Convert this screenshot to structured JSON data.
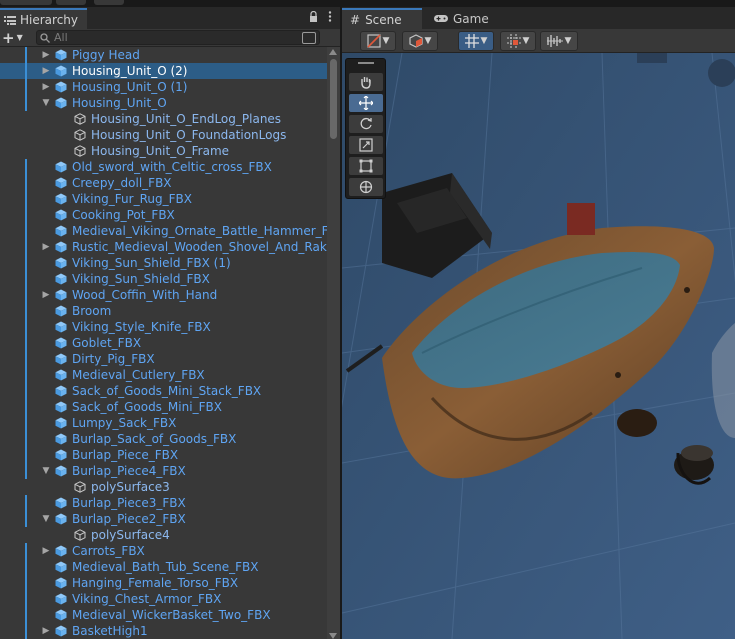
{
  "hierarchy": {
    "tab_title": "Hierarchy",
    "search_placeholder": "All",
    "items": [
      {
        "name": "Piggy Head",
        "arrow": "right",
        "depth": 0,
        "bar": true
      },
      {
        "name": "Housing_Unit_O (2)",
        "arrow": "right",
        "depth": 0,
        "bar": true,
        "selected": true
      },
      {
        "name": "Housing_Unit_O (1)",
        "arrow": "right",
        "depth": 0,
        "bar": true
      },
      {
        "name": "Housing_Unit_O",
        "arrow": "down",
        "depth": 0,
        "bar": true
      },
      {
        "name": "Housing_Unit_O_EndLog_Planes",
        "arrow": "",
        "depth": 1,
        "bar": false,
        "outline": true
      },
      {
        "name": "Housing_Unit_O_FoundationLogs",
        "arrow": "",
        "depth": 1,
        "bar": false,
        "outline": true
      },
      {
        "name": "Housing_Unit_O_Frame",
        "arrow": "",
        "depth": 1,
        "bar": false,
        "outline": true
      },
      {
        "name": "Old_sword_with_Celtic_cross_FBX",
        "arrow": "",
        "depth": 0,
        "bar": true
      },
      {
        "name": "Creepy_doll_FBX",
        "arrow": "",
        "depth": 0,
        "bar": true
      },
      {
        "name": "Viking_Fur_Rug_FBX",
        "arrow": "",
        "depth": 0,
        "bar": true
      },
      {
        "name": "Cooking_Pot_FBX",
        "arrow": "",
        "depth": 0,
        "bar": true
      },
      {
        "name": "Medieval_Viking_Ornate_Battle_Hammer_FBX",
        "arrow": "",
        "depth": 0,
        "bar": true
      },
      {
        "name": "Rustic_Medieval_Wooden_Shovel_And_Rake_",
        "arrow": "right",
        "depth": 0,
        "bar": true
      },
      {
        "name": "Viking_Sun_Shield_FBX (1)",
        "arrow": "",
        "depth": 0,
        "bar": true
      },
      {
        "name": "Viking_Sun_Shield_FBX",
        "arrow": "",
        "depth": 0,
        "bar": true
      },
      {
        "name": "Wood_Coffin_With_Hand",
        "arrow": "right",
        "depth": 0,
        "bar": true
      },
      {
        "name": "Broom",
        "arrow": "",
        "depth": 0,
        "bar": true
      },
      {
        "name": "Viking_Style_Knife_FBX",
        "arrow": "",
        "depth": 0,
        "bar": true
      },
      {
        "name": "Goblet_FBX",
        "arrow": "",
        "depth": 0,
        "bar": true
      },
      {
        "name": "Dirty_Pig_FBX",
        "arrow": "",
        "depth": 0,
        "bar": true
      },
      {
        "name": "Medieval_Cutlery_FBX",
        "arrow": "",
        "depth": 0,
        "bar": true
      },
      {
        "name": "Sack_of_Goods_Mini_Stack_FBX",
        "arrow": "",
        "depth": 0,
        "bar": true
      },
      {
        "name": "Sack_of_Goods_Mini_FBX",
        "arrow": "",
        "depth": 0,
        "bar": true
      },
      {
        "name": "Lumpy_Sack_FBX",
        "arrow": "",
        "depth": 0,
        "bar": true
      },
      {
        "name": "Burlap_Sack_of_Goods_FBX",
        "arrow": "",
        "depth": 0,
        "bar": true
      },
      {
        "name": "Burlap_Piece_FBX",
        "arrow": "",
        "depth": 0,
        "bar": true
      },
      {
        "name": "Burlap_Piece4_FBX",
        "arrow": "down",
        "depth": 0,
        "bar": true
      },
      {
        "name": "polySurface3",
        "arrow": "",
        "depth": 1,
        "bar": false,
        "outline": true
      },
      {
        "name": "Burlap_Piece3_FBX",
        "arrow": "",
        "depth": 0,
        "bar": true
      },
      {
        "name": "Burlap_Piece2_FBX",
        "arrow": "down",
        "depth": 0,
        "bar": true
      },
      {
        "name": "polySurface4",
        "arrow": "",
        "depth": 1,
        "bar": false,
        "outline": true
      },
      {
        "name": "Carrots_FBX",
        "arrow": "right",
        "depth": 0,
        "bar": true
      },
      {
        "name": "Medieval_Bath_Tub_Scene_FBX",
        "arrow": "",
        "depth": 0,
        "bar": true
      },
      {
        "name": "Hanging_Female_Torso_FBX",
        "arrow": "",
        "depth": 0,
        "bar": true
      },
      {
        "name": "Viking_Chest_Armor_FBX",
        "arrow": "",
        "depth": 0,
        "bar": true
      },
      {
        "name": "Medieval_WickerBasket_Two_FBX",
        "arrow": "",
        "depth": 0,
        "bar": true
      },
      {
        "name": "BasketHigh1",
        "arrow": "right",
        "depth": 0,
        "bar": true
      }
    ]
  },
  "scene": {
    "tabs": [
      {
        "label": "Scene",
        "icon": "grid-hash-icon"
      },
      {
        "label": "Game",
        "icon": "gamepad-icon"
      }
    ],
    "tools": [
      "hand-tool",
      "move-tool",
      "rotate-tool",
      "scale-tool",
      "rect-tool",
      "transform-tool"
    ],
    "active_tool": "move-tool"
  },
  "colors": {
    "selection": "#2c5d87",
    "prefab_text": "#5fa5f3",
    "tab_accent": "#3a79bb",
    "viewport_sky": "#34506f"
  }
}
